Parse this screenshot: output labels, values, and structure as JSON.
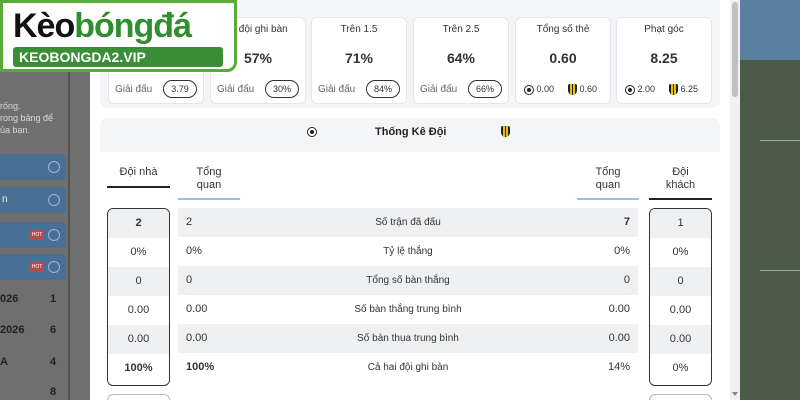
{
  "logo": {
    "brand_prefix": "Kèo",
    "brand_suffix": "bóngđá",
    "url": "KEOBONGDA2.VIP"
  },
  "bg_left": {
    "note_lines": [
      "rống.",
      "rong bảng để",
      "ủa bạn."
    ],
    "rows": [
      {
        "text": ""
      },
      {
        "text": "n"
      },
      {
        "text": "",
        "badge": "HOT"
      },
      {
        "text": "",
        "badge": "HOT"
      }
    ],
    "standings": [
      {
        "label": "026",
        "num": "1"
      },
      {
        "label": "2026",
        "num": "6"
      },
      {
        "label": "A",
        "num": "4"
      },
      {
        "label": "",
        "num": "8"
      }
    ]
  },
  "cards": [
    {
      "title": "ai đội ghi bàn",
      "value": "57%",
      "label": "Giải đấu",
      "pill": "30%"
    },
    {
      "title": "Trên 1.5",
      "value": "71%",
      "label": "Giải đấu",
      "pill": "84%"
    },
    {
      "title": "Trên 2.5",
      "value": "64%",
      "label": "Giải đấu",
      "pill": "66%"
    },
    {
      "title": "Tổng số thẻ",
      "value": "0.60",
      "home": "0.00",
      "away": "0.60"
    },
    {
      "title": "Phạt góc",
      "value": "8.25",
      "home": "2.00",
      "away": "6.25"
    }
  ],
  "first_card_pill": {
    "label": "Giải đấu",
    "pill": "3.79"
  },
  "team_stats": {
    "title": "Thống Kê Đội",
    "home_header": "Đội nhà",
    "home_overview": [
      "Tổng",
      "quan"
    ],
    "away_overview": [
      "Tổng",
      "quan"
    ],
    "away_header": [
      "Đội",
      "khách"
    ],
    "rows": [
      {
        "label": "Số trận đã đấu",
        "home": "2",
        "home_total": "2",
        "away_total": "7",
        "away": "1"
      },
      {
        "label": "Tỷ lệ thắng",
        "home": "0%",
        "home_total": "0%",
        "away_total": "0%",
        "away": "0%"
      },
      {
        "label": "Tổng số bàn thắng",
        "home": "0",
        "home_total": "0",
        "away_total": "0",
        "away": "0"
      },
      {
        "label": "Số bàn thắng trung bình",
        "home": "0.00",
        "home_total": "0.00",
        "away_total": "0.00",
        "away": "0.00"
      },
      {
        "label": "Số bàn thua trung bình",
        "home": "0.00",
        "home_total": "0.00",
        "away_total": "0.00",
        "away": "0.00"
      },
      {
        "label": "Cả hai đội ghi bàn",
        "home": "100%",
        "home_total": "100%",
        "away_total": "14%",
        "away": "0%"
      }
    ]
  },
  "colors": {
    "brand_green": "#3a8e35",
    "accent_blue": "#4a6f97",
    "hot_red": "#b54a4a",
    "crest_yellow": "#e7c20f"
  },
  "icons": {
    "home_team": "ball-icon",
    "away_team": "crest-icon",
    "scroll": "scroll-down-arrow-icon"
  }
}
